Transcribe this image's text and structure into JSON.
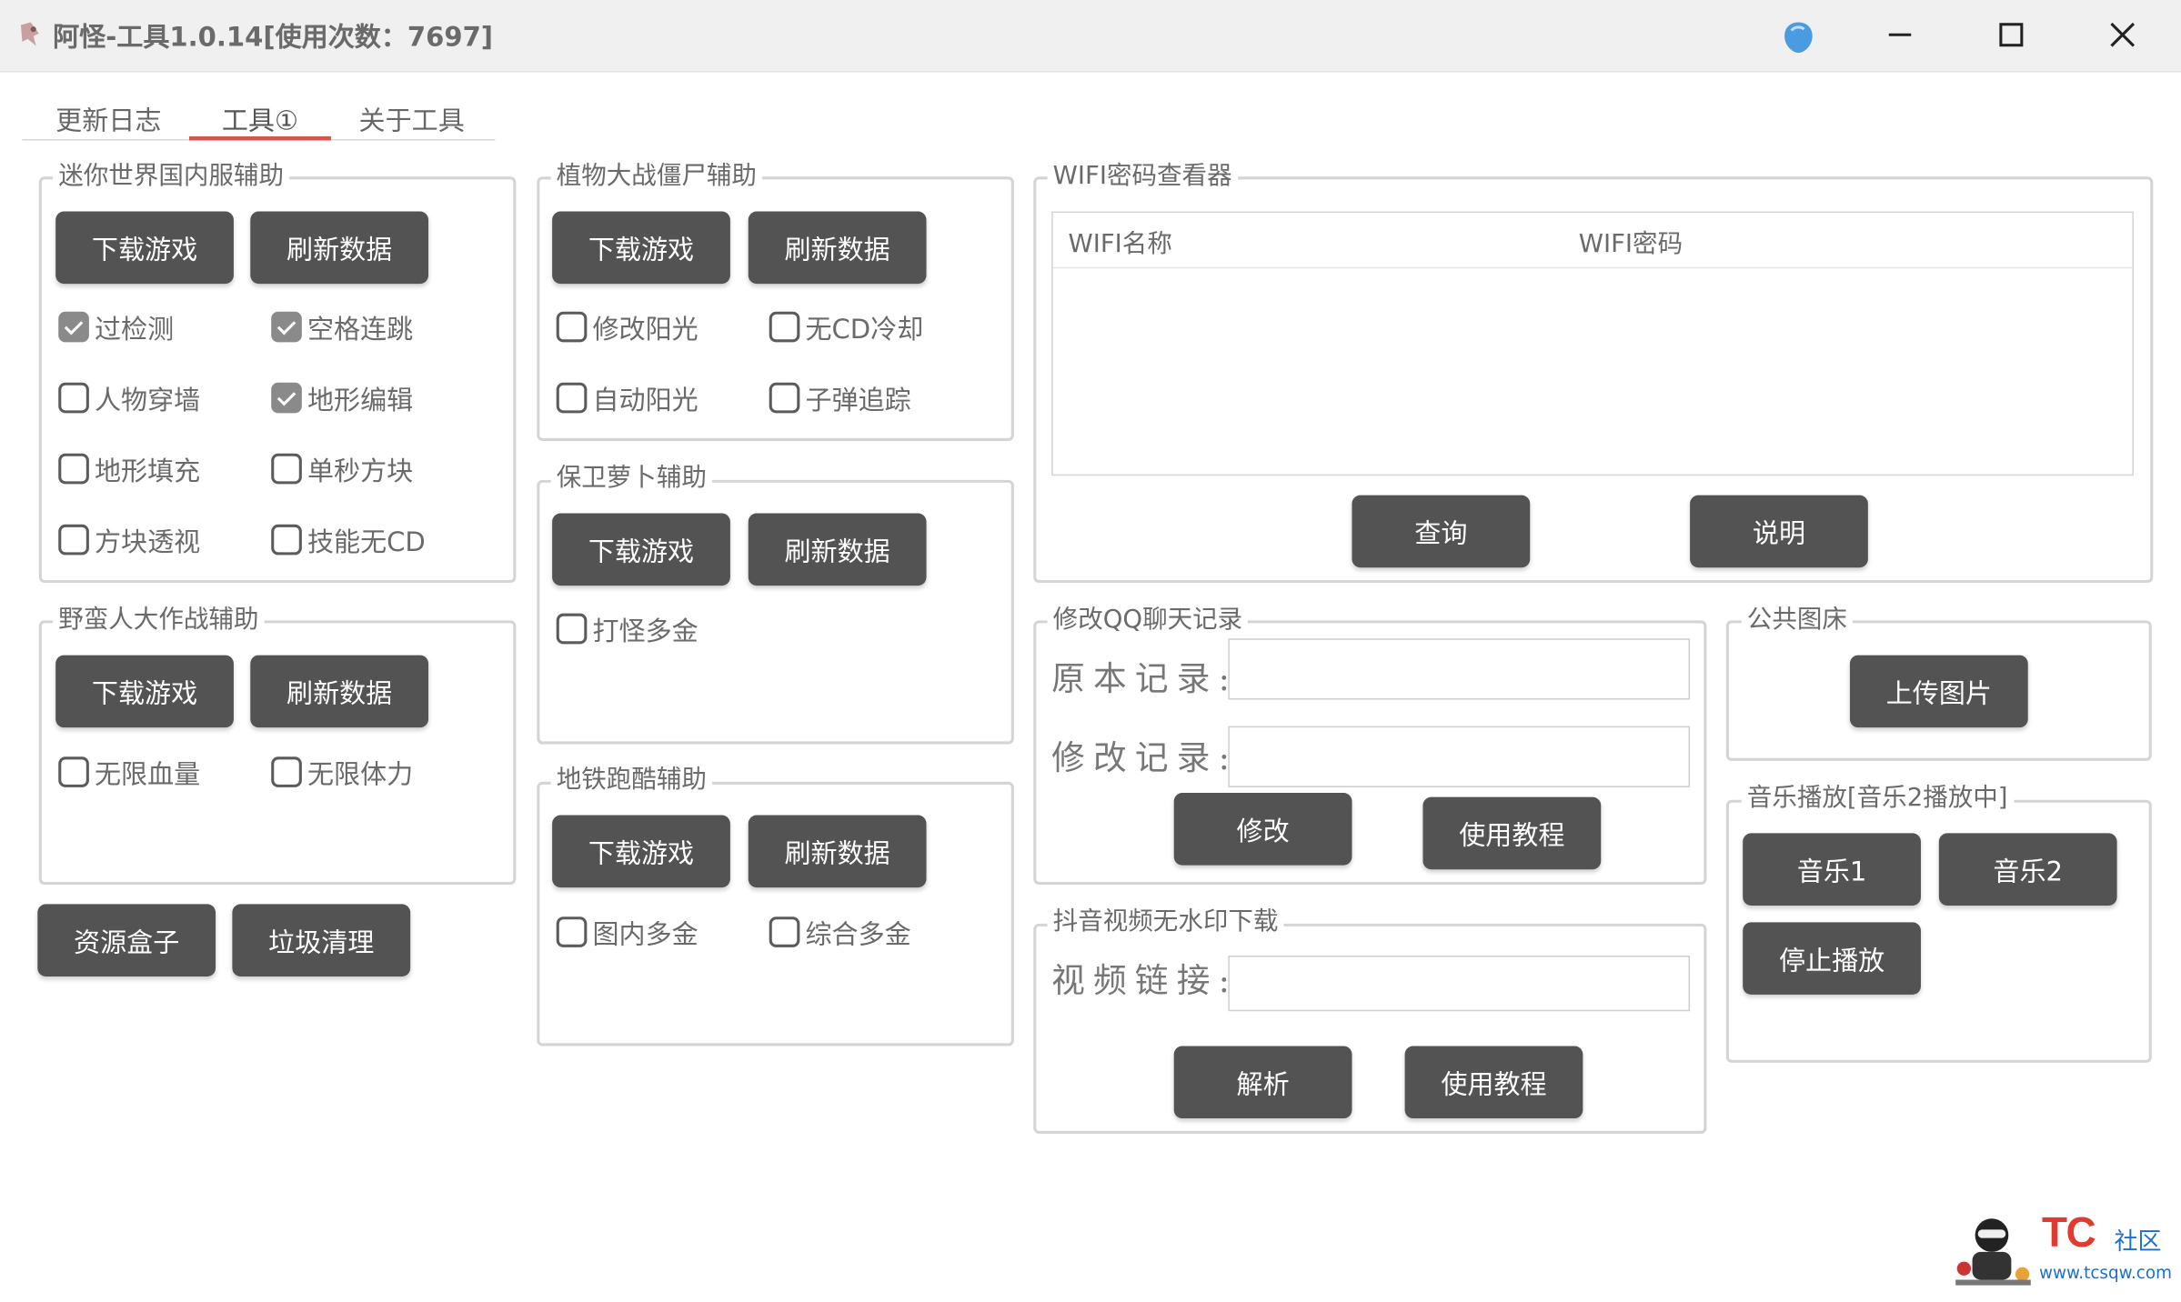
{
  "window": {
    "title": "阿怪-工具1.0.14[使用次数：7697]",
    "controls": {
      "minimize": "minimize-icon",
      "maximize": "maximize-icon",
      "close": "close-icon"
    }
  },
  "tabs": [
    {
      "label": "更新日志",
      "active": false
    },
    {
      "label": "工具①",
      "active": true
    },
    {
      "label": "关于工具",
      "active": false
    }
  ],
  "mini_world": {
    "title": "迷你世界国内服辅助",
    "download": "下载游戏",
    "refresh": "刷新数据",
    "options": [
      {
        "label": "过检测",
        "checked": true
      },
      {
        "label": "空格连跳",
        "checked": true
      },
      {
        "label": "人物穿墙",
        "checked": false
      },
      {
        "label": "地形编辑",
        "checked": true
      },
      {
        "label": "地形填充",
        "checked": false
      },
      {
        "label": "单秒方块",
        "checked": false
      },
      {
        "label": "方块透视",
        "checked": false
      },
      {
        "label": "技能无CD",
        "checked": false
      }
    ]
  },
  "savage": {
    "title": "野蛮人大作战辅助",
    "download": "下载游戏",
    "refresh": "刷新数据",
    "options": [
      {
        "label": "无限血量",
        "checked": false
      },
      {
        "label": "无限体力",
        "checked": false
      }
    ]
  },
  "bottom_buttons": {
    "resource_box": "资源盒子",
    "clean": "垃圾清理"
  },
  "pvz": {
    "title": "植物大战僵尸辅助",
    "download": "下载游戏",
    "refresh": "刷新数据",
    "options": [
      {
        "label": "修改阳光",
        "checked": false
      },
      {
        "label": "无CD冷却",
        "checked": false
      },
      {
        "label": "自动阳光",
        "checked": false
      },
      {
        "label": "子弹追踪",
        "checked": false
      }
    ]
  },
  "carrot": {
    "title": "保卫萝卜辅助",
    "download": "下载游戏",
    "refresh": "刷新数据",
    "options": [
      {
        "label": "打怪多金",
        "checked": false
      }
    ]
  },
  "subway": {
    "title": "地铁跑酷辅助",
    "download": "下载游戏",
    "refresh": "刷新数据",
    "options": [
      {
        "label": "图内多金",
        "checked": false
      },
      {
        "label": "综合多金",
        "checked": false
      }
    ]
  },
  "wifi": {
    "title": "WIFI密码查看器",
    "columns": [
      "WIFI名称",
      "WIFI密码"
    ],
    "rows": [],
    "query": "查询",
    "help": "说明"
  },
  "qq": {
    "title": "修改QQ聊天记录",
    "original_label": "原本记录:",
    "original_value": "",
    "modified_label": "修改记录:",
    "modified_value": "",
    "modify": "修改",
    "tutorial": "使用教程"
  },
  "douyin": {
    "title": "抖音视频无水印下载",
    "link_label": "视频链接:",
    "link_value": "",
    "parse": "解析",
    "tutorial": "使用教程"
  },
  "image_host": {
    "title": "公共图床",
    "upload": "上传图片"
  },
  "music": {
    "title": "音乐播放[音乐2播放中]",
    "music1": "音乐1",
    "music2": "音乐2",
    "stop": "停止播放"
  },
  "watermark": {
    "brand": "TC",
    "suffix": "社区",
    "url": "www.tcsqw.com"
  }
}
